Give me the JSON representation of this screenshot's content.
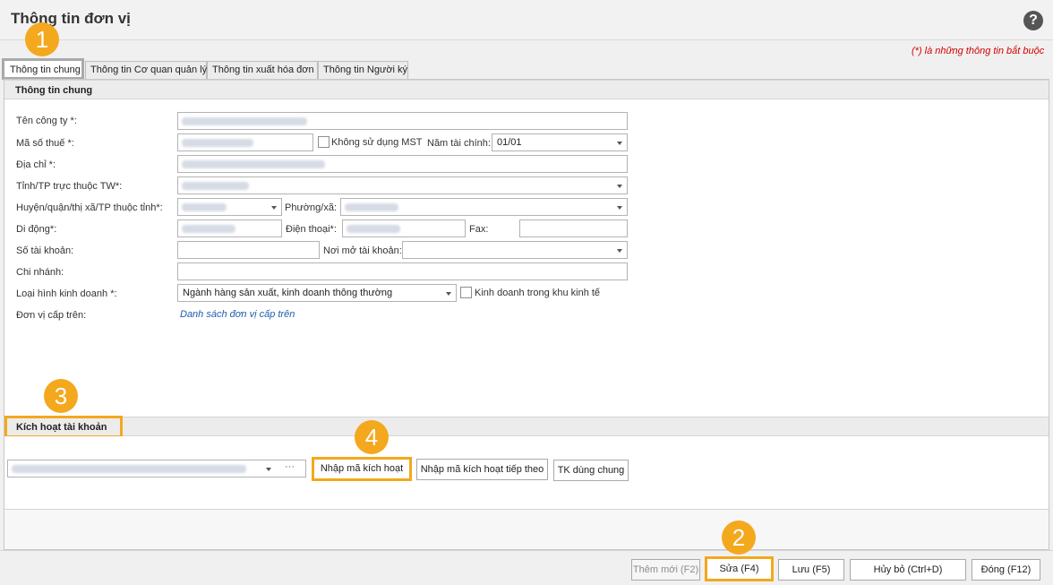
{
  "window": {
    "title": "Thông tin đơn vị",
    "help_icon": "?"
  },
  "required_note": "(*) là những thông tin bắt buộc",
  "tabs": [
    {
      "label": "Thông tin chung"
    },
    {
      "label": "Thông tin Cơ quan quản lý"
    },
    {
      "label": "Thông tin xuất hóa đơn"
    },
    {
      "label": "Thông tin Người ký"
    }
  ],
  "section_general": {
    "title": "Thông tin chung",
    "company_name_label": "Tên công ty *:",
    "tax_code_label": "Mã số thuế *:",
    "no_tax_code_label": "Không sử dụng MST",
    "fiscal_year_label": "Năm tài chính:",
    "fiscal_year_value": "01/01",
    "address_label": "Địa chỉ *:",
    "province_label": "Tỉnh/TP trực thuộc TW*:",
    "district_label": "Huyện/quận/thị xã/TP thuộc tỉnh*:",
    "ward_label": "Phường/xã:",
    "mobile_label": "Di động*:",
    "phone_label": "Điện thoại*:",
    "fax_label": "Fax:",
    "account_no_label": "Số tài khoản:",
    "bank_label": "Nơi mở tài khoản:",
    "branch_label": "Chi nhánh:",
    "business_type_label": "Loại hình kinh doanh *:",
    "business_type_value": "Ngành hàng sản xuất, kinh doanh thông thường",
    "economic_zone_label": "Kinh doanh trong khu kinh tế",
    "parent_unit_label": "Đơn vị cấp trên:",
    "parent_unit_link": "Danh sách đơn vị cấp trên"
  },
  "section_activation": {
    "title": "Kích hoạt tài khoản",
    "ellipsis": "···",
    "enter_code_button": "Nhập mã kích hoạt",
    "enter_next_code_button": "Nhập mã kích hoạt tiếp theo",
    "shared_account_button": "TK dùng chung"
  },
  "footer": {
    "add_new": "Thêm mới (F2)",
    "edit": "Sửa (F4)",
    "save": "Lưu (F5)",
    "cancel": "Hủy bỏ (Ctrl+D)",
    "close": "Đóng (F12)"
  },
  "annotations": [
    "1",
    "2",
    "3",
    "4"
  ],
  "colors": {
    "highlight": "#f4a81d",
    "required_note": "#d40000",
    "link": "#1d5cab"
  }
}
